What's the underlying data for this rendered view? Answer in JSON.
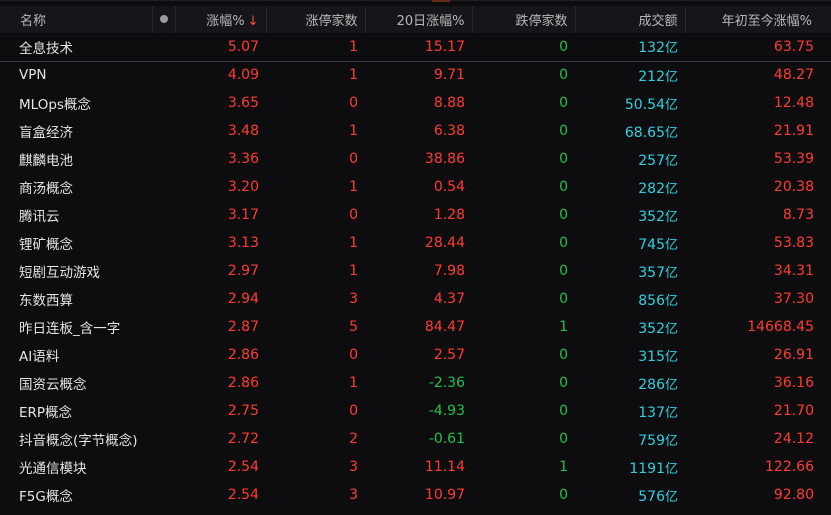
{
  "columns": {
    "name": "名称",
    "change_pct": "涨幅%",
    "sort_arrow": "↓",
    "limit_up": "涨停家数",
    "change_20d": "20日涨幅%",
    "limit_down": "跌停家数",
    "turnover": "成交额",
    "ytd": "年初至今涨幅%"
  },
  "colors": {
    "up": "#ff3b30",
    "down": "#21c24a",
    "turnover": "#2fd0e0",
    "background": "#0d0d0f"
  },
  "rows": [
    {
      "name": "全息技术",
      "pct": "5.07",
      "up": "1",
      "d20": "15.17",
      "down": "0",
      "amt": "132",
      "unit": "亿",
      "ytd": "63.75"
    },
    {
      "name": "VPN",
      "pct": "4.09",
      "up": "1",
      "d20": "9.71",
      "down": "0",
      "amt": "212",
      "unit": "亿",
      "ytd": "48.27"
    },
    {
      "name": "MLOps概念",
      "pct": "3.65",
      "up": "0",
      "d20": "8.88",
      "down": "0",
      "amt": "50.54",
      "unit": "亿",
      "ytd": "12.48"
    },
    {
      "name": "盲盒经济",
      "pct": "3.48",
      "up": "1",
      "d20": "6.38",
      "down": "0",
      "amt": "68.65",
      "unit": "亿",
      "ytd": "21.91"
    },
    {
      "name": "麒麟电池",
      "pct": "3.36",
      "up": "0",
      "d20": "38.86",
      "down": "0",
      "amt": "257",
      "unit": "亿",
      "ytd": "53.39"
    },
    {
      "name": "商汤概念",
      "pct": "3.20",
      "up": "1",
      "d20": "0.54",
      "down": "0",
      "amt": "282",
      "unit": "亿",
      "ytd": "20.38"
    },
    {
      "name": "腾讯云",
      "pct": "3.17",
      "up": "0",
      "d20": "1.28",
      "down": "0",
      "amt": "352",
      "unit": "亿",
      "ytd": "8.73"
    },
    {
      "name": "锂矿概念",
      "pct": "3.13",
      "up": "1",
      "d20": "28.44",
      "down": "0",
      "amt": "745",
      "unit": "亿",
      "ytd": "53.83"
    },
    {
      "name": "短剧互动游戏",
      "pct": "2.97",
      "up": "1",
      "d20": "7.98",
      "down": "0",
      "amt": "357",
      "unit": "亿",
      "ytd": "34.31"
    },
    {
      "name": "东数西算",
      "pct": "2.94",
      "up": "3",
      "d20": "4.37",
      "down": "0",
      "amt": "856",
      "unit": "亿",
      "ytd": "37.30"
    },
    {
      "name": "昨日连板_含一字",
      "pct": "2.87",
      "up": "5",
      "d20": "84.47",
      "down": "1",
      "amt": "352",
      "unit": "亿",
      "ytd": "14668.45"
    },
    {
      "name": "AI语料",
      "pct": "2.86",
      "up": "0",
      "d20": "2.57",
      "down": "0",
      "amt": "315",
      "unit": "亿",
      "ytd": "26.91"
    },
    {
      "name": "国资云概念",
      "pct": "2.86",
      "up": "1",
      "d20": "-2.36",
      "down": "0",
      "amt": "286",
      "unit": "亿",
      "ytd": "36.16"
    },
    {
      "name": "ERP概念",
      "pct": "2.75",
      "up": "0",
      "d20": "-4.93",
      "down": "0",
      "amt": "137",
      "unit": "亿",
      "ytd": "21.70"
    },
    {
      "name": "抖音概念(字节概念)",
      "pct": "2.72",
      "up": "2",
      "d20": "-0.61",
      "down": "0",
      "amt": "759",
      "unit": "亿",
      "ytd": "24.12"
    },
    {
      "name": "光通信模块",
      "pct": "2.54",
      "up": "3",
      "d20": "11.14",
      "down": "1",
      "amt": "1191",
      "unit": "亿",
      "ytd": "122.66"
    },
    {
      "name": "F5G概念",
      "pct": "2.54",
      "up": "3",
      "d20": "10.97",
      "down": "0",
      "amt": "576",
      "unit": "亿",
      "ytd": "92.80"
    }
  ]
}
